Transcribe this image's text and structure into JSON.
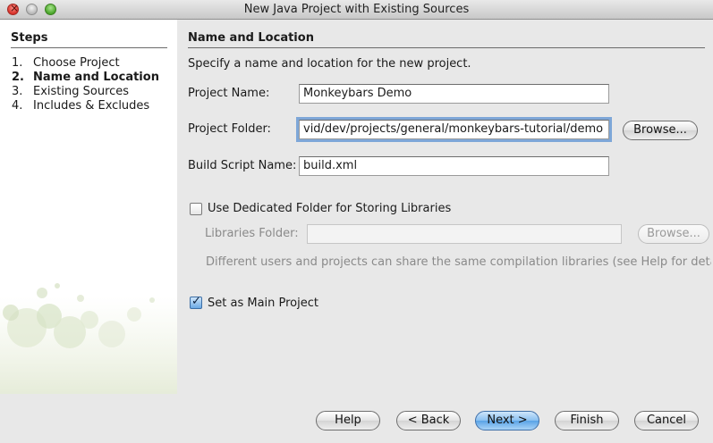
{
  "window": {
    "title": "New Java Project with Existing Sources"
  },
  "steps": {
    "title": "Steps",
    "items": [
      {
        "num": "1.",
        "label": "Choose Project",
        "active": false
      },
      {
        "num": "2.",
        "label": "Name and Location",
        "active": true
      },
      {
        "num": "3.",
        "label": "Existing Sources",
        "active": false
      },
      {
        "num": "4.",
        "label": "Includes & Excludes",
        "active": false
      }
    ]
  },
  "main": {
    "section_title": "Name and Location",
    "description": "Specify a name and location for the new project.",
    "project_name_label": "Project Name:",
    "project_name_value": "Monkeybars Demo",
    "project_folder_label": "Project Folder:",
    "project_folder_value": "vid/dev/projects/general/monkeybars-tutorial/demo",
    "browse_label": "Browse...",
    "build_script_label": "Build Script Name:",
    "build_script_value": "build.xml",
    "dedicated_folder_label": "Use Dedicated Folder for Storing Libraries",
    "dedicated_folder_checked": false,
    "libraries_folder_label": "Libraries Folder:",
    "libraries_folder_value": "",
    "libraries_browse_label": "Browse...",
    "share_note": "Different users and projects can share the same compilation libraries (see Help for detail",
    "main_project_label": "Set as Main Project",
    "main_project_checked": true
  },
  "footer": {
    "help_label": "Help",
    "back_label": "< Back",
    "next_label": "Next >",
    "finish_label": "Finish",
    "cancel_label": "Cancel"
  }
}
